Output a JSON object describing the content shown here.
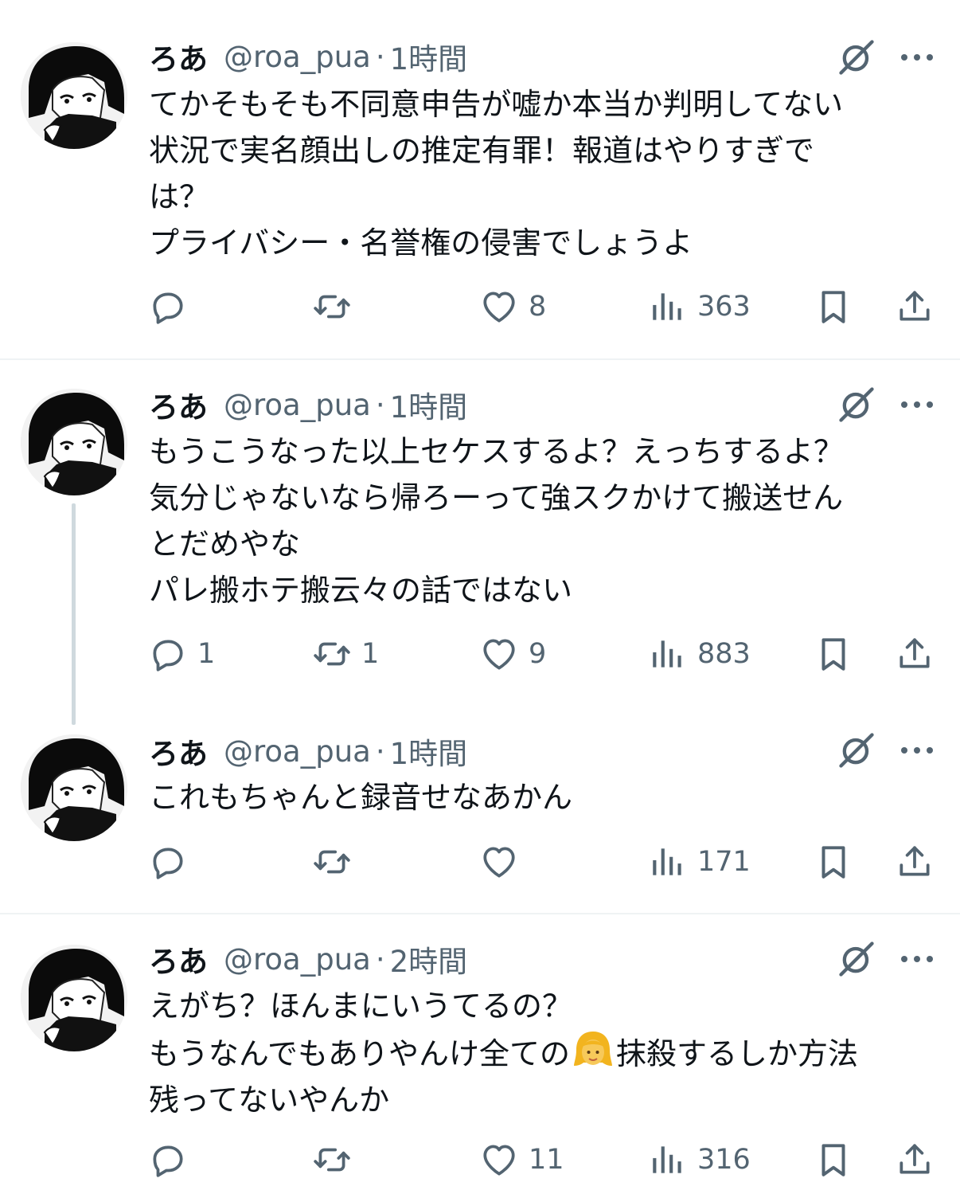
{
  "tweets": [
    {
      "name": "ろあ",
      "handle": "@roa_pua",
      "dot": "·",
      "time": "1時間",
      "lines": [
        "てかそもそも不同意申告が嘘か本当か判明してない",
        "状況で実名顔出しの推定有罪！報道はやりすぎで",
        "は？",
        "プライバシー・名誉権の侵害でしょうよ"
      ],
      "replies": "",
      "retweets": "",
      "likes": "8",
      "views": "363"
    },
    {
      "name": "ろあ",
      "handle": "@roa_pua",
      "dot": "·",
      "time": "1時間",
      "lines": [
        "もうこうなった以上セケスするよ？えっちするよ？",
        "気分じゃないなら帰ろーって強スクかけて搬送せん",
        "とだめやな",
        "パレ搬ホテ搬云々の話ではない"
      ],
      "replies": "1",
      "retweets": "1",
      "likes": "9",
      "views": "883"
    },
    {
      "name": "ろあ",
      "handle": "@roa_pua",
      "dot": "·",
      "time": "1時間",
      "lines": [
        "これもちゃんと録音せなあかん"
      ],
      "replies": "",
      "retweets": "",
      "likes": "",
      "views": "171"
    },
    {
      "name": "ろあ",
      "handle": "@roa_pua",
      "dot": "·",
      "time": "2時間",
      "lines": [
        "えがち？ほんまにいうてるの？",
        "もうなんでもありやんけ全ての",
        "残ってないやんか"
      ],
      "line2_after_emoji": "抹殺するしか方法",
      "emoji_name": "woman-emoji",
      "replies": "",
      "retweets": "",
      "likes": "11",
      "views": "316"
    }
  ],
  "icons": {
    "reply": "reply-icon",
    "retweet": "retweet-icon",
    "like": "heart-icon",
    "views": "views-icon",
    "bookmark": "bookmark-icon",
    "share": "share-icon",
    "grok": "grok-icon",
    "more": "more-icon"
  },
  "colors": {
    "text": "#0f1419",
    "secondary": "#536471",
    "separator": "#eff3f4",
    "thread_line": "#cfd9de"
  }
}
